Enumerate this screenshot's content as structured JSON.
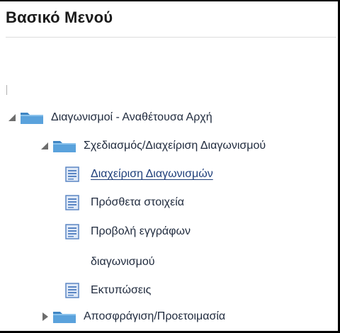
{
  "panel": {
    "title": "Βασικό Μενού"
  },
  "tree": {
    "root": {
      "label": "Διαγωνισμοί - Αναθέτουσα Αρχή",
      "icon": "folder-icon",
      "state": "expanded"
    },
    "group": {
      "label": "Σχεδιασμός/Διαχείριση Διαγωνισμού",
      "icon": "folder-icon",
      "state": "expanded"
    },
    "items": [
      {
        "label": "Διαχείριση Διαγωνισμών",
        "icon": "document-icon",
        "style": "link"
      },
      {
        "label": "Πρόσθετα στοιχεία",
        "icon": "document-icon"
      },
      {
        "label": "Προβολή εγγράφων",
        "icon": "document-icon"
      },
      {
        "label": "διαγωνισμού",
        "icon": ""
      },
      {
        "label": "Εκτυπώσεις",
        "icon": "document-icon"
      }
    ],
    "collapsed_group": {
      "label": "Αποσφράγιση/Προετοιμασία",
      "icon": "folder-icon",
      "state": "collapsed"
    }
  },
  "colors": {
    "folder": "#4a90c9",
    "document": "#5b86c4",
    "link": "#1f3f7a",
    "text": "#1f2a3d"
  }
}
